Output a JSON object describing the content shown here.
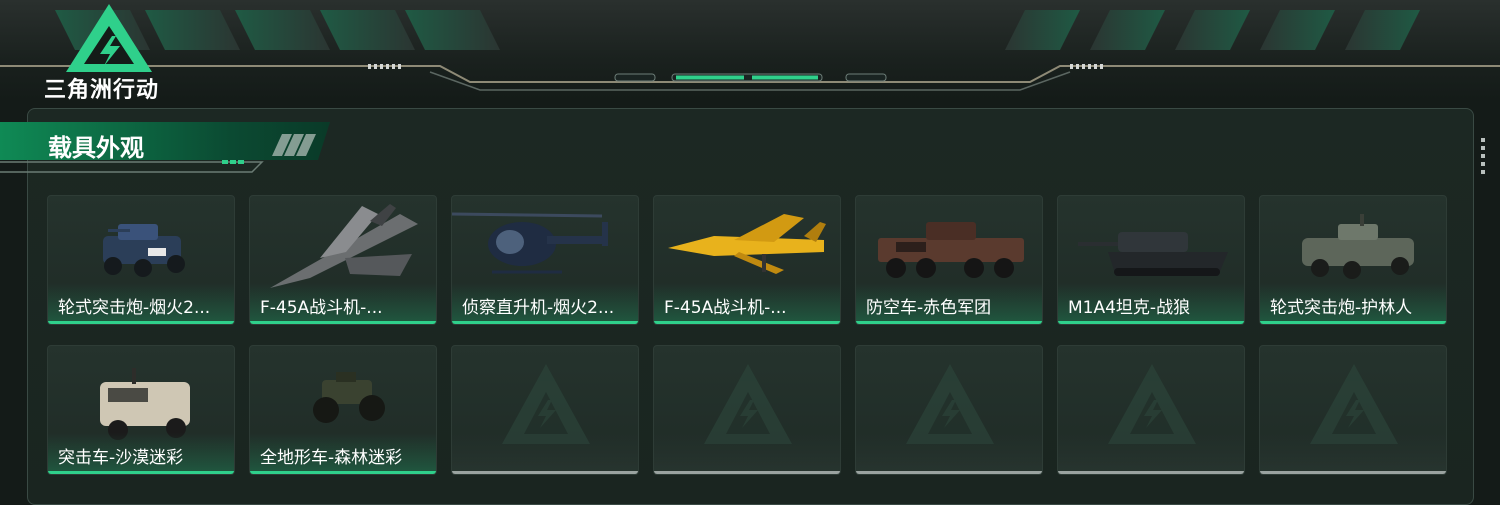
{
  "brand": {
    "logo_text": "三角洲行动"
  },
  "section": {
    "title": "载具外观"
  },
  "colors": {
    "accent": "#2fd08b",
    "panel": "#1c2823",
    "empty_bar": "#9aa3a0"
  },
  "vehicles": [
    {
      "label": "轮式突击炮-烟火2...",
      "icon": "wheeled-assault-gun-icon",
      "camo": "navy-digital"
    },
    {
      "label": "F-45A战斗机-...",
      "icon": "fighter-jet-icon",
      "camo": "grey-splinter"
    },
    {
      "label": "侦察直升机-烟火2...",
      "icon": "scout-helicopter-icon",
      "camo": "navy"
    },
    {
      "label": "F-45A战斗机-...",
      "icon": "fighter-jet-icon",
      "camo": "yellow"
    },
    {
      "label": "防空车-赤色军团",
      "icon": "anti-air-vehicle-icon",
      "camo": "red-black"
    },
    {
      "label": "M1A4坦克-战狼",
      "icon": "tank-icon",
      "camo": "dark-grey"
    },
    {
      "label": "轮式突击炮-护林人",
      "icon": "wheeled-assault-gun-icon",
      "camo": "woodland-grey"
    },
    {
      "label": "突击车-沙漠迷彩",
      "icon": "assault-vehicle-icon",
      "camo": "desert"
    },
    {
      "label": "全地形车-森林迷彩",
      "icon": "atv-icon",
      "camo": "forest"
    }
  ],
  "empty_slots": 5
}
